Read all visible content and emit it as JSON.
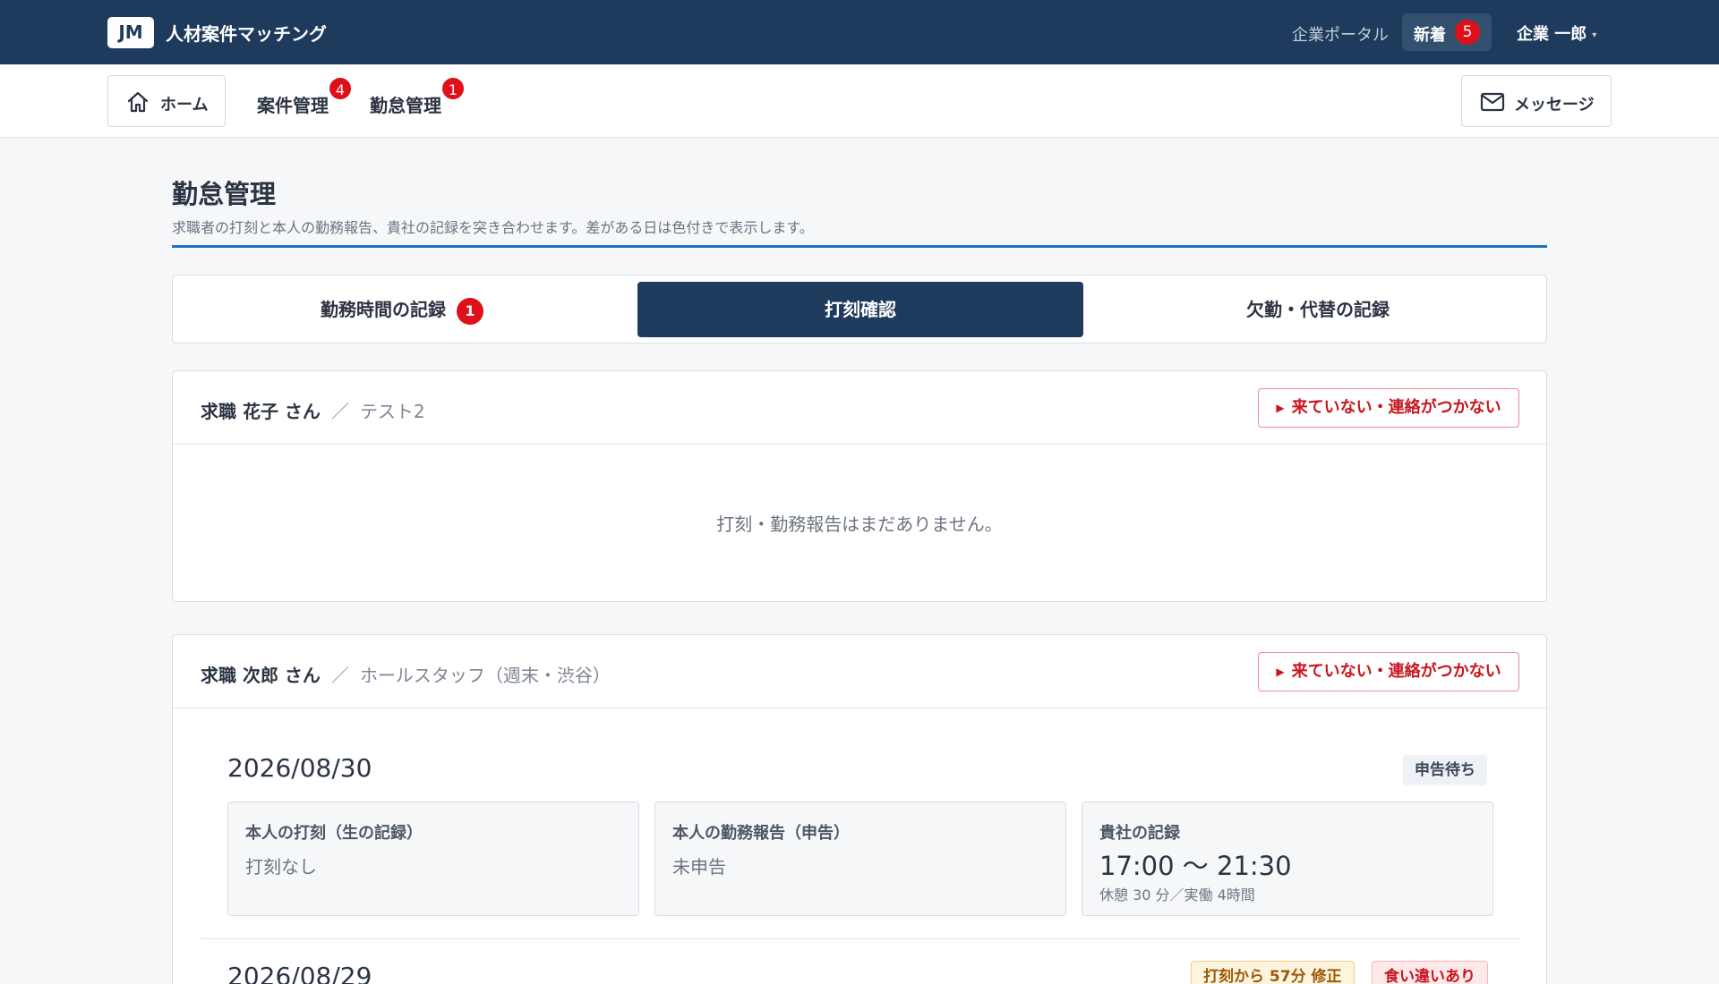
{
  "app": {
    "logo": "JM",
    "title": "人材案件マッチング",
    "portal_link": "企業ポータル",
    "new_label": "新着",
    "new_count": "5",
    "user_name": "企業 一郎",
    "user_caret": "▾"
  },
  "subnav": {
    "home_label": "ホーム",
    "projects_label": "案件管理",
    "projects_badge": "4",
    "attendance_label": "勤怠管理",
    "attendance_badge": "1",
    "message_label": "メッセージ"
  },
  "page": {
    "title": "勤怠管理",
    "description": "求職者の打刻と本人の勤務報告、貴社の記録を突き合わせます。差がある日は色付きで表示します。"
  },
  "tabs": [
    {
      "label": "勤務時間の記録",
      "badge": "1",
      "active": false
    },
    {
      "label": "打刻確認",
      "active": true
    },
    {
      "label": "欠勤・代替の記録",
      "active": false
    }
  ],
  "cards": [
    {
      "name": "求職 花子 さん",
      "separator": "／",
      "job": "テスト2",
      "alert_label": "来ていない・連絡がつかない",
      "empty_message": "打刻・勤務報告はまだありません。"
    },
    {
      "name": "求職 次郎 さん",
      "separator": "／",
      "job": "ホールスタッフ（週末・渋谷）",
      "alert_label": "来ていない・連絡がつかない",
      "days": [
        {
          "date": "2026/08/30",
          "status": "申告待ち",
          "punch": {
            "title": "本人の打刻（生の記録）",
            "value": "打刻なし"
          },
          "report": {
            "title": "本人の勤務報告（申告）",
            "value": "未申告"
          },
          "company": {
            "title": "貴社の記録",
            "time": "17:00 〜 21:30",
            "detail": "休憩 30 分／実働 4時間"
          }
        },
        {
          "date": "2026/08/29",
          "badges": [
            "打刻から 57分 修正",
            "食い違いあり"
          ]
        }
      ]
    }
  ],
  "colors": {
    "navy": "#1e3a5c",
    "accent_blue": "#1e6fc2",
    "badge_red": "#e0101b",
    "alert_red": "#c8161e"
  },
  "icons": {
    "home": "home-icon",
    "message": "envelope-icon",
    "alert": "triangle-right-icon"
  }
}
